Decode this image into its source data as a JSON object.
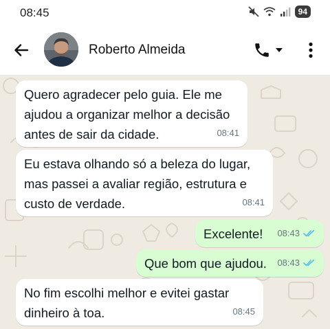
{
  "status_bar": {
    "time": "08:45",
    "battery": "94",
    "icons": [
      "mute-icon",
      "wifi-icon",
      "signal-icon",
      "battery-icon"
    ]
  },
  "header": {
    "contact_name": "Roberto Almeida",
    "icons": [
      "back-arrow-icon",
      "phone-icon",
      "dropdown-icon",
      "more-vertical-icon"
    ]
  },
  "colors": {
    "incoming_bubble": "#ffffff",
    "outgoing_bubble": "#d9fdd3",
    "read_ticks": "#53bdeb",
    "wallpaper": "#efeae2"
  },
  "messages": [
    {
      "direction": "in",
      "text": "Quero agradecer pelo guia. Ele me\najudou a organizar melhor a decisão\nantes de sair da cidade.",
      "time": "08:41"
    },
    {
      "direction": "in",
      "text": "Eu estava olhando só a beleza do lugar,\nmas passei a avaliar região, estrutura e\ncusto de verdade.",
      "time": "08:41"
    },
    {
      "direction": "out",
      "text": "Excelente!",
      "time": "08:43",
      "status": "read"
    },
    {
      "direction": "out",
      "text": "Que bom que ajudou.",
      "time": "08:43",
      "status": "read"
    },
    {
      "direction": "in",
      "text": "No fim escolhi melhor e evitei gastar\ndinheiro à toa.",
      "time": "08:45"
    }
  ]
}
